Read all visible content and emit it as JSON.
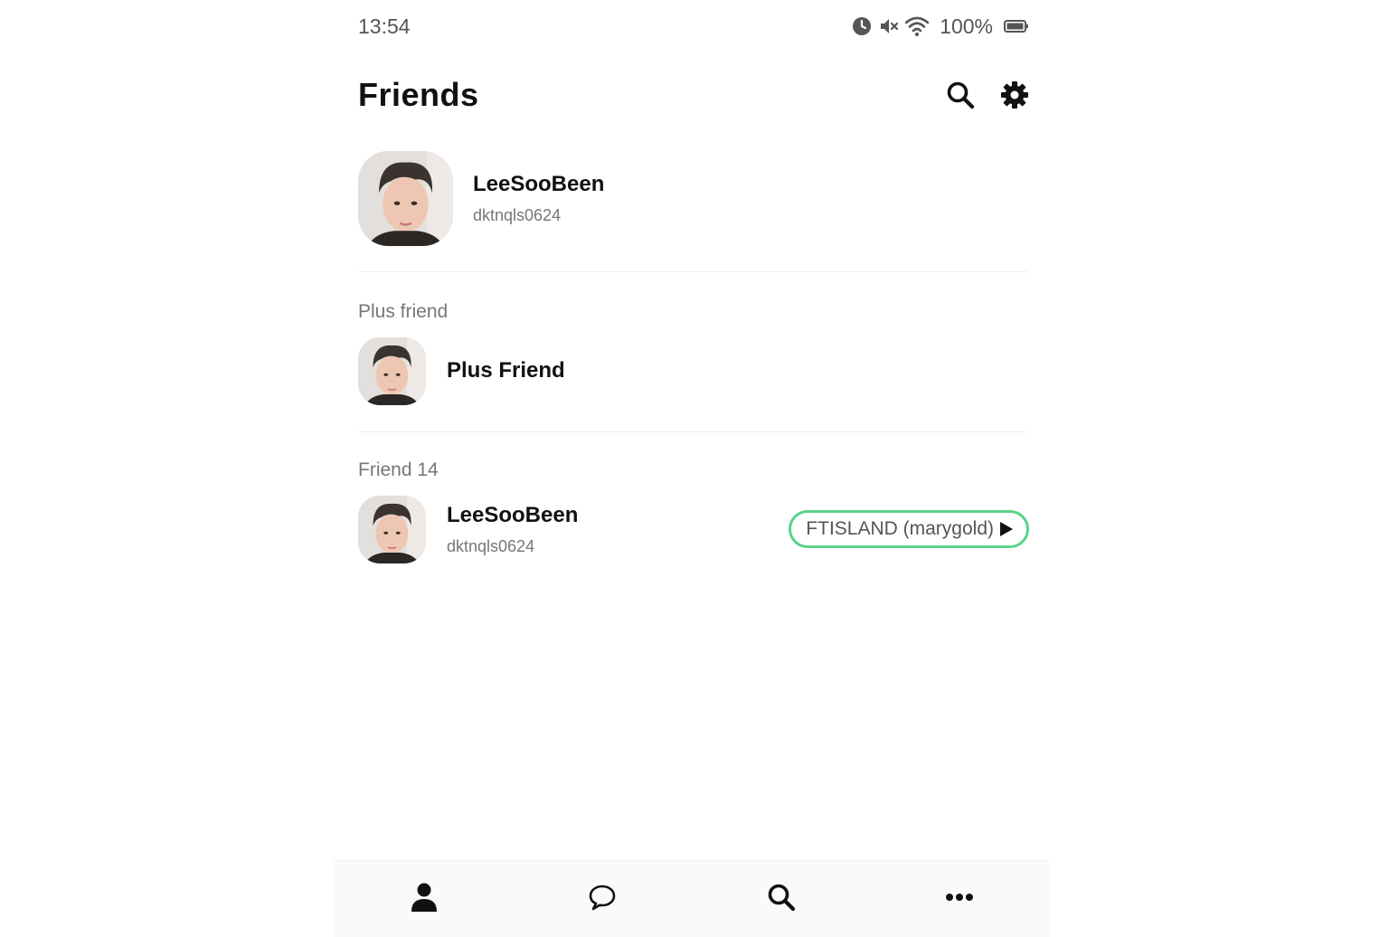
{
  "status_bar": {
    "time": "13:54",
    "battery": "100%",
    "icons": [
      "alarm-icon",
      "mute-icon",
      "wifi-icon",
      "battery-icon"
    ]
  },
  "header": {
    "title": "Friends",
    "actions": [
      "search-icon",
      "gear-icon"
    ]
  },
  "my_profile": {
    "name": "LeeSooBeen",
    "id": "dktnqls0624"
  },
  "sections": {
    "plus_friend": {
      "label": "Plus friend",
      "item": {
        "name": "Plus Friend"
      }
    },
    "friends": {
      "label": "Friend 14",
      "items": [
        {
          "name": "LeeSooBeen",
          "id": "dktnqls0624",
          "music": "FTISLAND (marygold)"
        }
      ]
    }
  },
  "bottom_nav": {
    "items": [
      "person-icon",
      "chat-bubble-icon",
      "search-icon",
      "more-dots-icon"
    ]
  },
  "colors": {
    "accent_green": "#5ad38a",
    "text_primary": "#111111",
    "text_secondary": "#777777"
  }
}
